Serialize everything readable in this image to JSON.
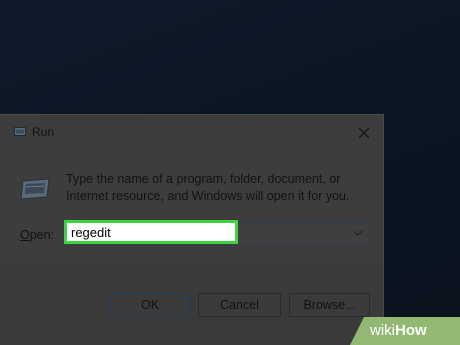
{
  "window": {
    "title": "Run",
    "close_glyph": "✕"
  },
  "body": {
    "description": "Type the name of a program, folder, document, or Internet resource, and Windows will open it for you."
  },
  "open_field": {
    "label_underlined": "O",
    "label_rest": "pen:",
    "value": "regedit",
    "highlight_color": "#3fd43f"
  },
  "buttons": {
    "ok": "OK",
    "cancel": "Cancel",
    "browse": "Browse..."
  },
  "icons": {
    "title": "run-icon",
    "body": "run-program-icon",
    "dropdown": "chevron-down-icon",
    "close": "close-icon"
  },
  "watermark": {
    "prefix": "wiki",
    "suffix": "How",
    "color": "#93b874"
  }
}
